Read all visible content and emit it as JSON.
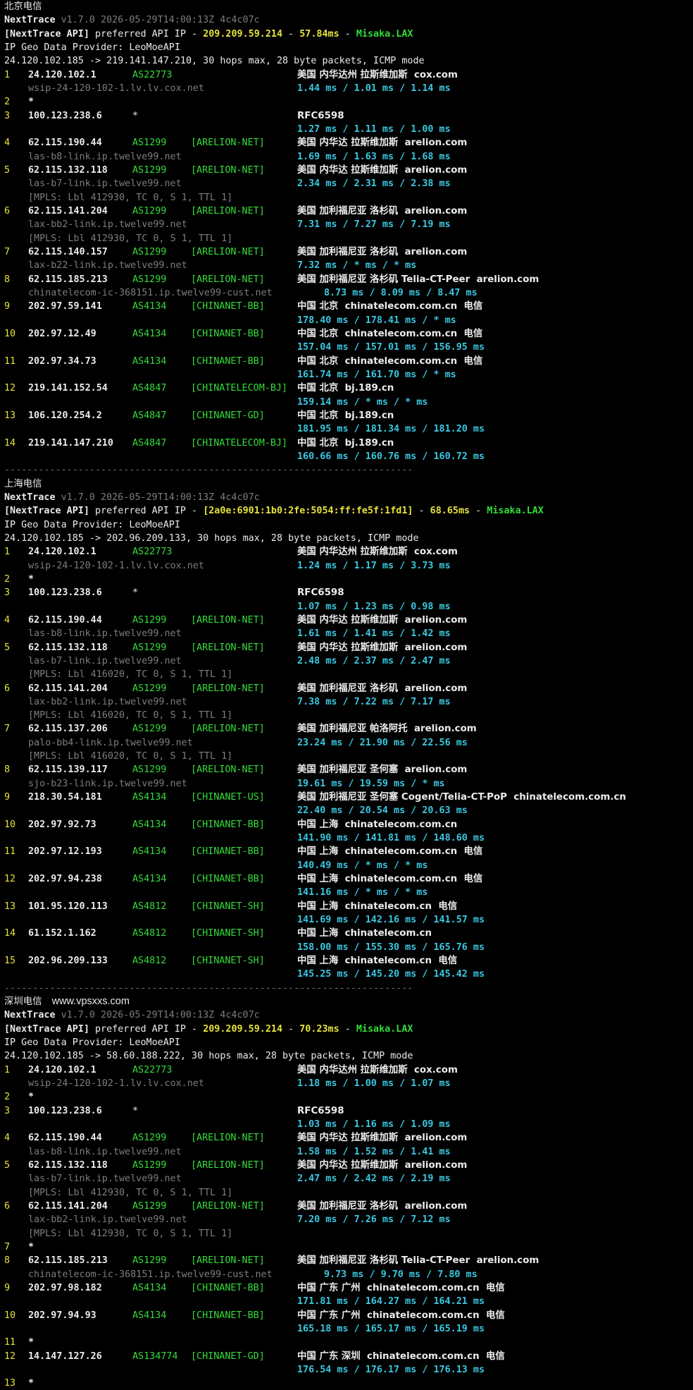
{
  "sections": [
    {
      "label": "北京电信",
      "version_line": "v1.7.0 2026-05-29T14:00:13Z 4c4c07c",
      "api_ip": "209.209.59.214",
      "api_latency": "57.84ms",
      "api_node": "Misaka.LAX",
      "geo_provider": "LeoMoeAPI",
      "route": "24.120.102.185 -> 219.141.147.210, 30 hops max, 28 byte packets, ICMP mode",
      "hops": [
        {
          "n": "1",
          "ip": "24.120.102.1",
          "asn": "AS22773",
          "tag": "",
          "geo": "美国 内华达州 拉斯维加斯",
          "dom": "cox.com",
          "host": "wsip-24-120-102-1.lv.lv.cox.net",
          "times": "1.44 ms / 1.01 ms / 1.14 ms"
        },
        {
          "n": "2",
          "ip": "*"
        },
        {
          "n": "3",
          "ip": "100.123.238.6",
          "asn": "*",
          "tag": "",
          "geo": "RFC6598",
          "dom": "",
          "times": "1.27 ms / 1.11 ms / 1.00 ms"
        },
        {
          "n": "4",
          "ip": "62.115.190.44",
          "asn": "AS1299",
          "tag": "[ARELION-NET]",
          "geo": "美国 内华达 拉斯维加斯",
          "dom": "arelion.com",
          "host": "las-b8-link.ip.twelve99.net",
          "times": "1.69 ms / 1.63 ms / 1.68 ms"
        },
        {
          "n": "5",
          "ip": "62.115.132.118",
          "asn": "AS1299",
          "tag": "[ARELION-NET]",
          "geo": "美国 内华达 拉斯维加斯",
          "dom": "arelion.com",
          "host": "las-b7-link.ip.twelve99.net",
          "times": "2.34 ms / 2.31 ms / 2.38 ms",
          "mpls": "[MPLS: Lbl 412930, TC 0, S 1, TTL 1]"
        },
        {
          "n": "6",
          "ip": "62.115.141.204",
          "asn": "AS1299",
          "tag": "[ARELION-NET]",
          "geo": "美国 加利福尼亚 洛杉矶",
          "dom": "arelion.com",
          "host": "lax-bb2-link.ip.twelve99.net",
          "times": "7.31 ms / 7.27 ms / 7.19 ms",
          "mpls": "[MPLS: Lbl 412930, TC 0, S 1, TTL 1]"
        },
        {
          "n": "7",
          "ip": "62.115.140.157",
          "asn": "AS1299",
          "tag": "[ARELION-NET]",
          "geo": "美国 加利福尼亚 洛杉矶",
          "dom": "arelion.com",
          "host": "lax-b22-link.ip.twelve99.net",
          "times": "7.32 ms / * ms / * ms"
        },
        {
          "n": "8",
          "ip": "62.115.185.213",
          "asn": "AS1299",
          "tag": "[ARELION-NET]",
          "geo": "美国 加利福尼亚 洛杉矶 Telia-CT-Peer",
          "dom": "arelion.com",
          "host": "chinatelecom-ic-368151.ip.twelve99-cust.net",
          "times": "8.73 ms / 8.09 ms / 8.47 ms"
        },
        {
          "n": "9",
          "ip": "202.97.59.141",
          "asn": "AS4134",
          "tag": "[CHINANET-BB]",
          "geo": "中国 北京",
          "dom": "chinatelecom.com.cn",
          "isp": "电信",
          "times": "178.40 ms / 178.41 ms / * ms"
        },
        {
          "n": "10",
          "ip": "202.97.12.49",
          "asn": "AS4134",
          "tag": "[CHINANET-BB]",
          "geo": "中国 北京",
          "dom": "chinatelecom.com.cn",
          "isp": "电信",
          "times": "157.04 ms / 157.01 ms / 156.95 ms"
        },
        {
          "n": "11",
          "ip": "202.97.34.73",
          "asn": "AS4134",
          "tag": "[CHINANET-BB]",
          "geo": "中国 北京",
          "dom": "chinatelecom.com.cn",
          "isp": "电信",
          "times": "161.74 ms / 161.70 ms / * ms"
        },
        {
          "n": "12",
          "ip": "219.141.152.54",
          "asn": "AS4847",
          "tag": "[CHINATELECOM-BJ]",
          "geo": "中国 北京",
          "dom": "bj.189.cn",
          "times": "159.14 ms / * ms / * ms"
        },
        {
          "n": "13",
          "ip": "106.120.254.2",
          "asn": "AS4847",
          "tag": "[CHINANET-GD]",
          "geo": "中国 北京",
          "dom": "bj.189.cn",
          "times": "181.95 ms / 181.34 ms / 181.20 ms"
        },
        {
          "n": "14",
          "ip": "219.141.147.210",
          "asn": "AS4847",
          "tag": "[CHINATELECOM-BJ]",
          "geo": "中国 北京",
          "dom": "bj.189.cn",
          "times": "160.66 ms / 160.76 ms / 160.72 ms"
        }
      ]
    },
    {
      "label": "上海电信",
      "version_line": "v1.7.0 2026-05-29T14:00:13Z 4c4c07c",
      "api_ip": "[2a0e:6901:1b0:2fe:5054:ff:fe5f:1fd1]",
      "api_latency": "68.65ms",
      "api_node": "Misaka.LAX",
      "geo_provider": "LeoMoeAPI",
      "route": "24.120.102.185 -> 202.96.209.133, 30 hops max, 28 byte packets, ICMP mode",
      "hops": [
        {
          "n": "1",
          "ip": "24.120.102.1",
          "asn": "AS22773",
          "tag": "",
          "geo": "美国 内华达州 拉斯维加斯",
          "dom": "cox.com",
          "host": "wsip-24-120-102-1.lv.lv.cox.net",
          "times": "1.24 ms / 1.17 ms / 3.73 ms"
        },
        {
          "n": "2",
          "ip": "*"
        },
        {
          "n": "3",
          "ip": "100.123.238.6",
          "asn": "*",
          "tag": "",
          "geo": "RFC6598",
          "dom": "",
          "times": "1.07 ms / 1.23 ms / 0.98 ms"
        },
        {
          "n": "4",
          "ip": "62.115.190.44",
          "asn": "AS1299",
          "tag": "[ARELION-NET]",
          "geo": "美国 内华达 拉斯维加斯",
          "dom": "arelion.com",
          "host": "las-b8-link.ip.twelve99.net",
          "times": "1.61 ms / 1.41 ms / 1.42 ms"
        },
        {
          "n": "5",
          "ip": "62.115.132.118",
          "asn": "AS1299",
          "tag": "[ARELION-NET]",
          "geo": "美国 内华达 拉斯维加斯",
          "dom": "arelion.com",
          "host": "las-b7-link.ip.twelve99.net",
          "times": "2.48 ms / 2.37 ms / 2.47 ms",
          "mpls": "[MPLS: Lbl 416020, TC 0, S 1, TTL 1]"
        },
        {
          "n": "6",
          "ip": "62.115.141.204",
          "asn": "AS1299",
          "tag": "[ARELION-NET]",
          "geo": "美国 加利福尼亚 洛杉矶",
          "dom": "arelion.com",
          "host": "lax-bb2-link.ip.twelve99.net",
          "times": "7.38 ms / 7.22 ms / 7.17 ms",
          "mpls": "[MPLS: Lbl 416020, TC 0, S 1, TTL 1]"
        },
        {
          "n": "7",
          "ip": "62.115.137.206",
          "asn": "AS1299",
          "tag": "[ARELION-NET]",
          "geo": "美国 加利福尼亚 帕洛阿托",
          "dom": "arelion.com",
          "host": "palo-bb4-link.ip.twelve99.net",
          "times": "23.24 ms / 21.90 ms / 22.56 ms",
          "mpls": "[MPLS: Lbl 416020, TC 0, S 1, TTL 1]"
        },
        {
          "n": "8",
          "ip": "62.115.139.117",
          "asn": "AS1299",
          "tag": "[ARELION-NET]",
          "geo": "美国 加利福尼亚 圣何塞",
          "dom": "arelion.com",
          "host": "sjo-b23-link.ip.twelve99.net",
          "times": "19.61 ms / 19.59 ms / * ms"
        },
        {
          "n": "9",
          "ip": "218.30.54.181",
          "asn": "AS4134",
          "tag": "[CHINANET-US]",
          "geo": "美国 加利福尼亚 圣何塞 Cogent/Telia-CT-PoP",
          "dom": "chinatelecom.com.cn",
          "times": "22.40 ms / 20.54 ms / 20.63 ms"
        },
        {
          "n": "10",
          "ip": "202.97.92.73",
          "asn": "AS4134",
          "tag": "[CHINANET-BB]",
          "geo": "中国 上海",
          "dom": "chinatelecom.com.cn",
          "times": "141.90 ms / 141.81 ms / 148.60 ms"
        },
        {
          "n": "11",
          "ip": "202.97.12.193",
          "asn": "AS4134",
          "tag": "[CHINANET-BB]",
          "geo": "中国 上海",
          "dom": "chinatelecom.com.cn",
          "isp": "电信",
          "times": "140.49 ms / * ms / * ms"
        },
        {
          "n": "12",
          "ip": "202.97.94.238",
          "asn": "AS4134",
          "tag": "[CHINANET-BB]",
          "geo": "中国 上海",
          "dom": "chinatelecom.com.cn",
          "isp": "电信",
          "times": "141.16 ms / * ms / * ms"
        },
        {
          "n": "13",
          "ip": "101.95.120.113",
          "asn": "AS4812",
          "tag": "[CHINANET-SH]",
          "geo": "中国 上海",
          "dom": "chinatelecom.cn",
          "isp": "电信",
          "times": "141.69 ms / 142.16 ms / 141.57 ms"
        },
        {
          "n": "14",
          "ip": "61.152.1.162",
          "asn": "AS4812",
          "tag": "[CHINANET-SH]",
          "geo": "中国 上海",
          "dom": "chinatelecom.cn",
          "times": "158.00 ms / 155.30 ms / 165.76 ms"
        },
        {
          "n": "15",
          "ip": "202.96.209.133",
          "asn": "AS4812",
          "tag": "[CHINANET-SH]",
          "geo": "中国 上海",
          "dom": "chinatelecom.cn",
          "isp": "电信",
          "times": "145.25 ms / 145.20 ms / 145.42 ms"
        }
      ]
    },
    {
      "label": "深圳电信",
      "watermark": "www.vpsxxs.com",
      "version_line": "v1.7.0 2026-05-29T14:00:13Z 4c4c07c",
      "api_ip": "209.209.59.214",
      "api_latency": "70.23ms",
      "api_node": "Misaka.LAX",
      "geo_provider": "LeoMoeAPI",
      "route": "24.120.102.185 -> 58.60.188.222, 30 hops max, 28 byte packets, ICMP mode",
      "hops": [
        {
          "n": "1",
          "ip": "24.120.102.1",
          "asn": "AS22773",
          "tag": "",
          "geo": "美国 内华达州 拉斯维加斯",
          "dom": "cox.com",
          "host": "wsip-24-120-102-1.lv.lv.cox.net",
          "times": "1.18 ms / 1.00 ms / 1.07 ms"
        },
        {
          "n": "2",
          "ip": "*"
        },
        {
          "n": "3",
          "ip": "100.123.238.6",
          "asn": "*",
          "tag": "",
          "geo": "RFC6598",
          "dom": "",
          "times": "1.03 ms / 1.16 ms / 1.09 ms"
        },
        {
          "n": "4",
          "ip": "62.115.190.44",
          "asn": "AS1299",
          "tag": "[ARELION-NET]",
          "geo": "美国 内华达 拉斯维加斯",
          "dom": "arelion.com",
          "host": "las-b8-link.ip.twelve99.net",
          "times": "1.58 ms / 1.52 ms / 1.41 ms"
        },
        {
          "n": "5",
          "ip": "62.115.132.118",
          "asn": "AS1299",
          "tag": "[ARELION-NET]",
          "geo": "美国 内华达 拉斯维加斯",
          "dom": "arelion.com",
          "host": "las-b7-link.ip.twelve99.net",
          "times": "2.47 ms / 2.42 ms / 2.19 ms",
          "mpls": "[MPLS: Lbl 412930, TC 0, S 1, TTL 1]"
        },
        {
          "n": "6",
          "ip": "62.115.141.204",
          "asn": "AS1299",
          "tag": "[ARELION-NET]",
          "geo": "美国 加利福尼亚 洛杉矶",
          "dom": "arelion.com",
          "host": "lax-bb2-link.ip.twelve99.net",
          "times": "7.20 ms / 7.26 ms / 7.12 ms",
          "mpls": "[MPLS: Lbl 412930, TC 0, S 1, TTL 1]"
        },
        {
          "n": "7",
          "ip": "*"
        },
        {
          "n": "8",
          "ip": "62.115.185.213",
          "asn": "AS1299",
          "tag": "[ARELION-NET]",
          "geo": "美国 加利福尼亚 洛杉矶 Telia-CT-Peer",
          "dom": "arelion.com",
          "host": "chinatelecom-ic-368151.ip.twelve99-cust.net",
          "times": "9.73 ms / 9.70 ms / 7.80 ms"
        },
        {
          "n": "9",
          "ip": "202.97.98.182",
          "asn": "AS4134",
          "tag": "[CHINANET-BB]",
          "geo": "中国 广东 广州",
          "dom": "chinatelecom.com.cn",
          "isp": "电信",
          "times": "171.81 ms / 164.27 ms / 164.21 ms"
        },
        {
          "n": "10",
          "ip": "202.97.94.93",
          "asn": "AS4134",
          "tag": "[CHINANET-BB]",
          "geo": "中国 广东 广州",
          "dom": "chinatelecom.com.cn",
          "isp": "电信",
          "times": "165.18 ms / 165.17 ms / 165.19 ms"
        },
        {
          "n": "11",
          "ip": "*"
        },
        {
          "n": "12",
          "ip": "14.147.127.26",
          "asn": "AS134774",
          "tag": "[CHINANET-GD]",
          "geo": "中国 广东 深圳",
          "dom": "chinatelecom.com.cn",
          "isp": "电信",
          "times": "176.54 ms / 176.17 ms / 176.13 ms"
        },
        {
          "n": "13",
          "ip": "*"
        }
      ]
    }
  ],
  "static": {
    "app_name": "NextTrace",
    "api_label": "[NextTrace API]",
    "api_text": " preferred API IP - ",
    "geo_label": "IP Geo Data Provider: ",
    "separator": "------------------------------------------------------------------------"
  }
}
